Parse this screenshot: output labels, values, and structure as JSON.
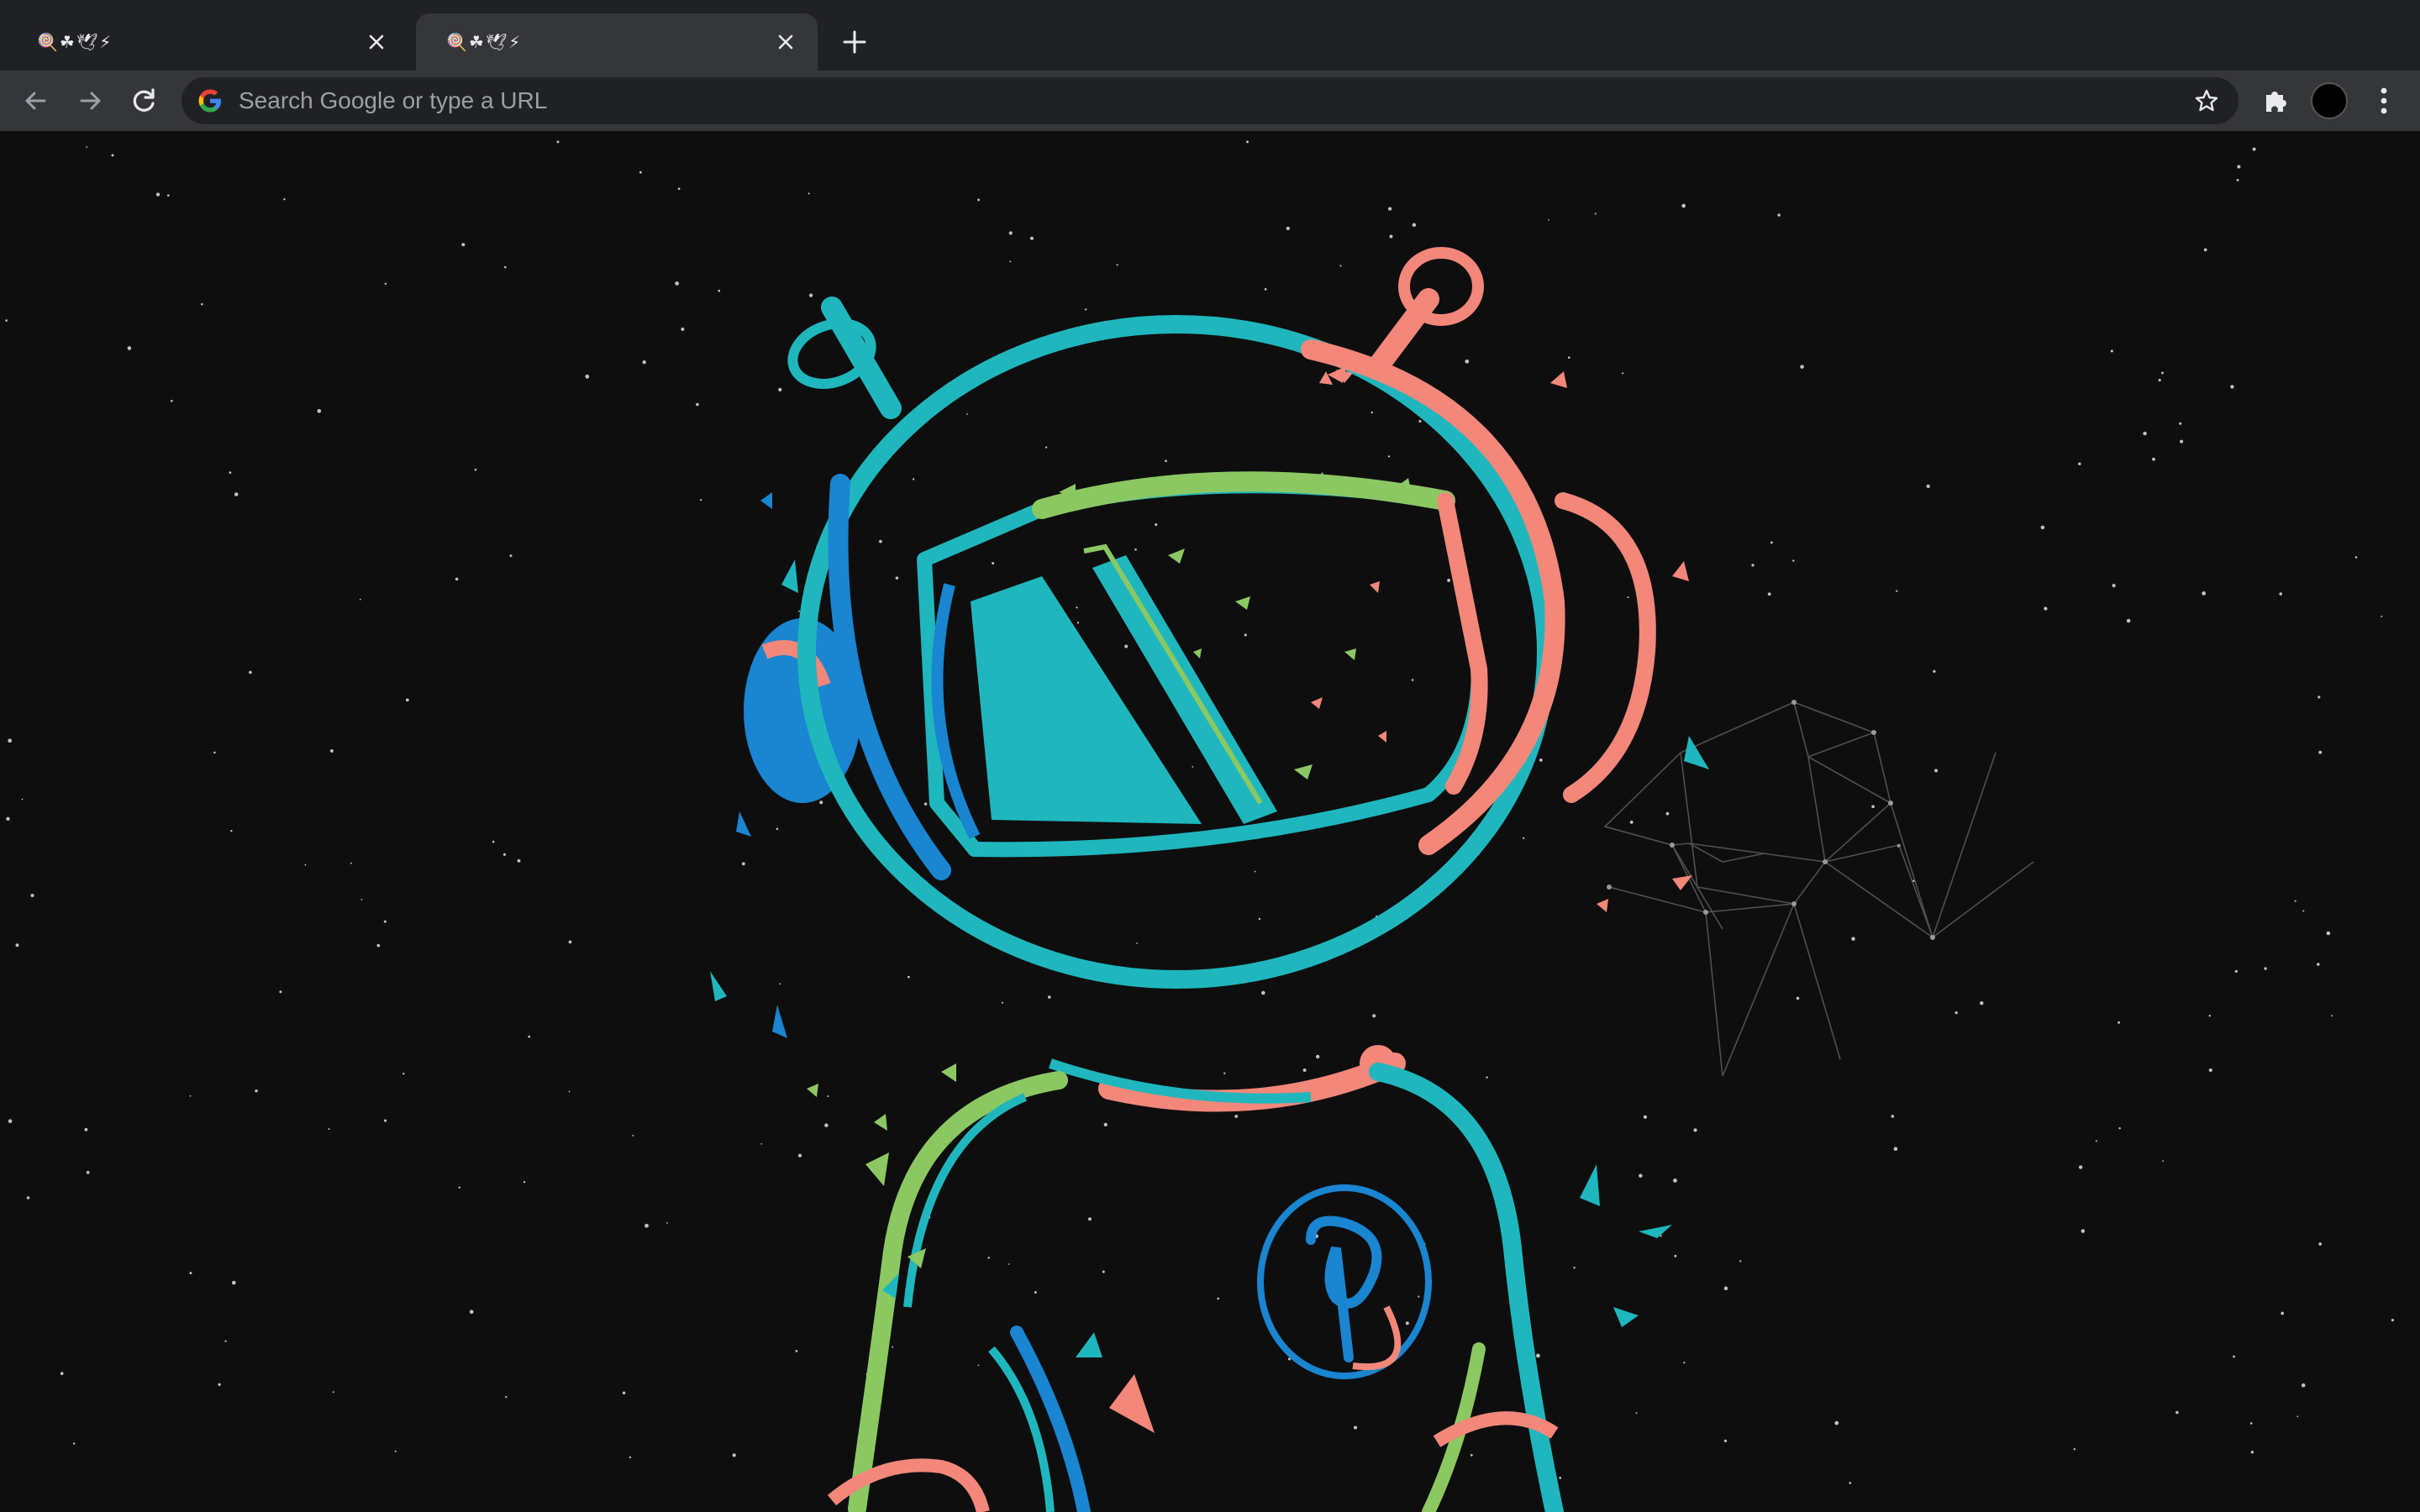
{
  "tabs": [
    {
      "title": "🍭☘🕊⚡",
      "state": "inactive"
    },
    {
      "title": "🍭☘🕊⚡",
      "state": "active"
    }
  ],
  "icons": {
    "back": "arrow-left-icon",
    "forward": "arrow-right-icon",
    "reload": "reload-icon",
    "search_engine": "google-logo-icon",
    "bookmark": "star-icon",
    "extensions": "puzzle-icon",
    "menu": "kebab-menu-icon",
    "close": "close-icon",
    "new_tab": "plus-icon"
  },
  "omnibox": {
    "placeholder": "Search Google or type a URL"
  },
  "colors": {
    "tabstrip": "#202124",
    "toolbar": "#35363a",
    "background": "#0e0e0f",
    "art_teal": "#1fb7bd",
    "art_blue": "#1a85d0",
    "art_green": "#8cc862",
    "art_coral": "#f2877a"
  },
  "wallpaper": {
    "subject": "astronaut-illustration"
  }
}
